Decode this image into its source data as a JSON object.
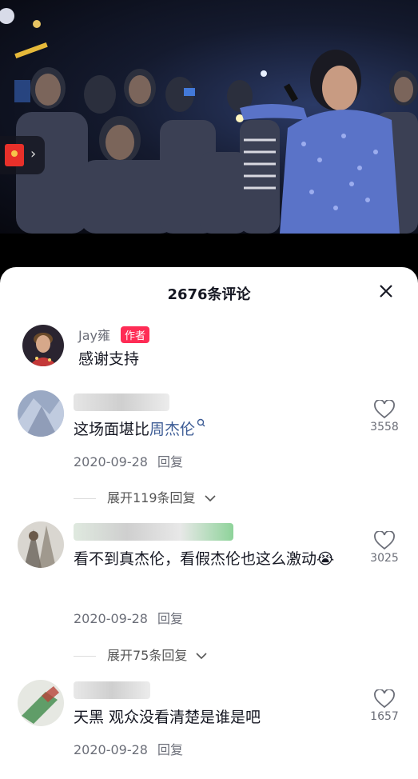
{
  "video": {
    "colors": {
      "background": "#0b0e1a",
      "stage_light": "#eef2ff",
      "jacket": "#5a73c8"
    }
  },
  "overlay": {
    "icon": "red-packet-icon",
    "chevron": "›"
  },
  "sheet": {
    "title": "2676条评论",
    "close_icon": "close-icon"
  },
  "author_comment": {
    "name": "Jay雍",
    "tag": "作者",
    "text": "感谢支持"
  },
  "comments": [
    {
      "text_plain": "这场面堪比",
      "text_link": "周杰伦",
      "link_icon": "search-icon",
      "date": "2020-09-28",
      "reply": "回复",
      "likes": "3558",
      "expand": "展开119条回复"
    },
    {
      "text_plain": "看不到真杰伦，看假杰伦也这么激动",
      "emoji": "😭",
      "date": "2020-09-28",
      "reply": "回复",
      "likes": "3025",
      "expand": "展开75条回复"
    },
    {
      "text_plain": "天黑 观众没看清楚是谁是吧",
      "date": "2020-09-28",
      "reply": "回复",
      "likes": "1657"
    }
  ],
  "colors": {
    "accent": "#fe2c55",
    "link": "#3d5c95",
    "meta": "#6b6e78",
    "text": "#161823"
  }
}
